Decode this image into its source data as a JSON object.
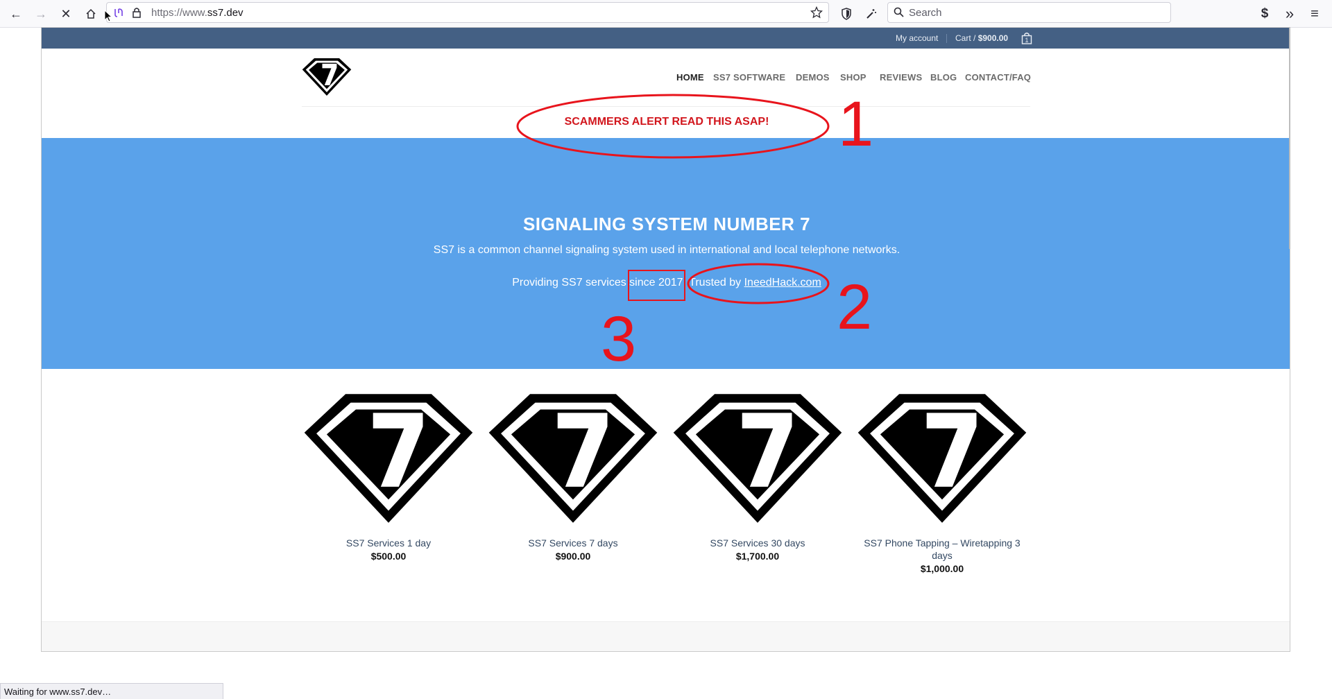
{
  "browser": {
    "url_scheme": "https://www.",
    "url_host": "ss7.dev",
    "search_placeholder": "Search",
    "status_text": "Waiting for www.ss7.dev…"
  },
  "topbar": {
    "account_label": "My account",
    "cart_label": "Cart /",
    "cart_total": "$900.00",
    "cart_count": "1"
  },
  "nav": {
    "items": [
      "HOME",
      "SS7 SOFTWARE",
      "DEMOS",
      "SHOP",
      "REVIEWS",
      "BLOG",
      "CONTACT/FAQ"
    ]
  },
  "alert": {
    "text": "SCAMMERS ALERT READ THIS ASAP!"
  },
  "hero": {
    "title": "SIGNALING SYSTEM NUMBER 7",
    "description": "SS7 is a common channel signaling system used in international and local telephone networks.",
    "line2_prefix": "Providing SS7 services since 2017. Trusted by ",
    "line2_link": "IneedHack.com"
  },
  "annotations": {
    "mark1": "1",
    "mark2": "2",
    "mark3": "3",
    "color": "#e8141c"
  },
  "products": [
    {
      "name": "SS7 Services 1 day",
      "price": "$500.00"
    },
    {
      "name": "SS7 Services 7 days",
      "price": "$900.00"
    },
    {
      "name": "SS7 Services 30 days",
      "price": "$1,700.00"
    },
    {
      "name": "SS7 Phone Tapping – Wiretapping 3 days",
      "price": "$1,000.00"
    }
  ],
  "colors": {
    "topbar": "#446084",
    "hero": "#5aa2ea",
    "alert": "#d2161d"
  }
}
